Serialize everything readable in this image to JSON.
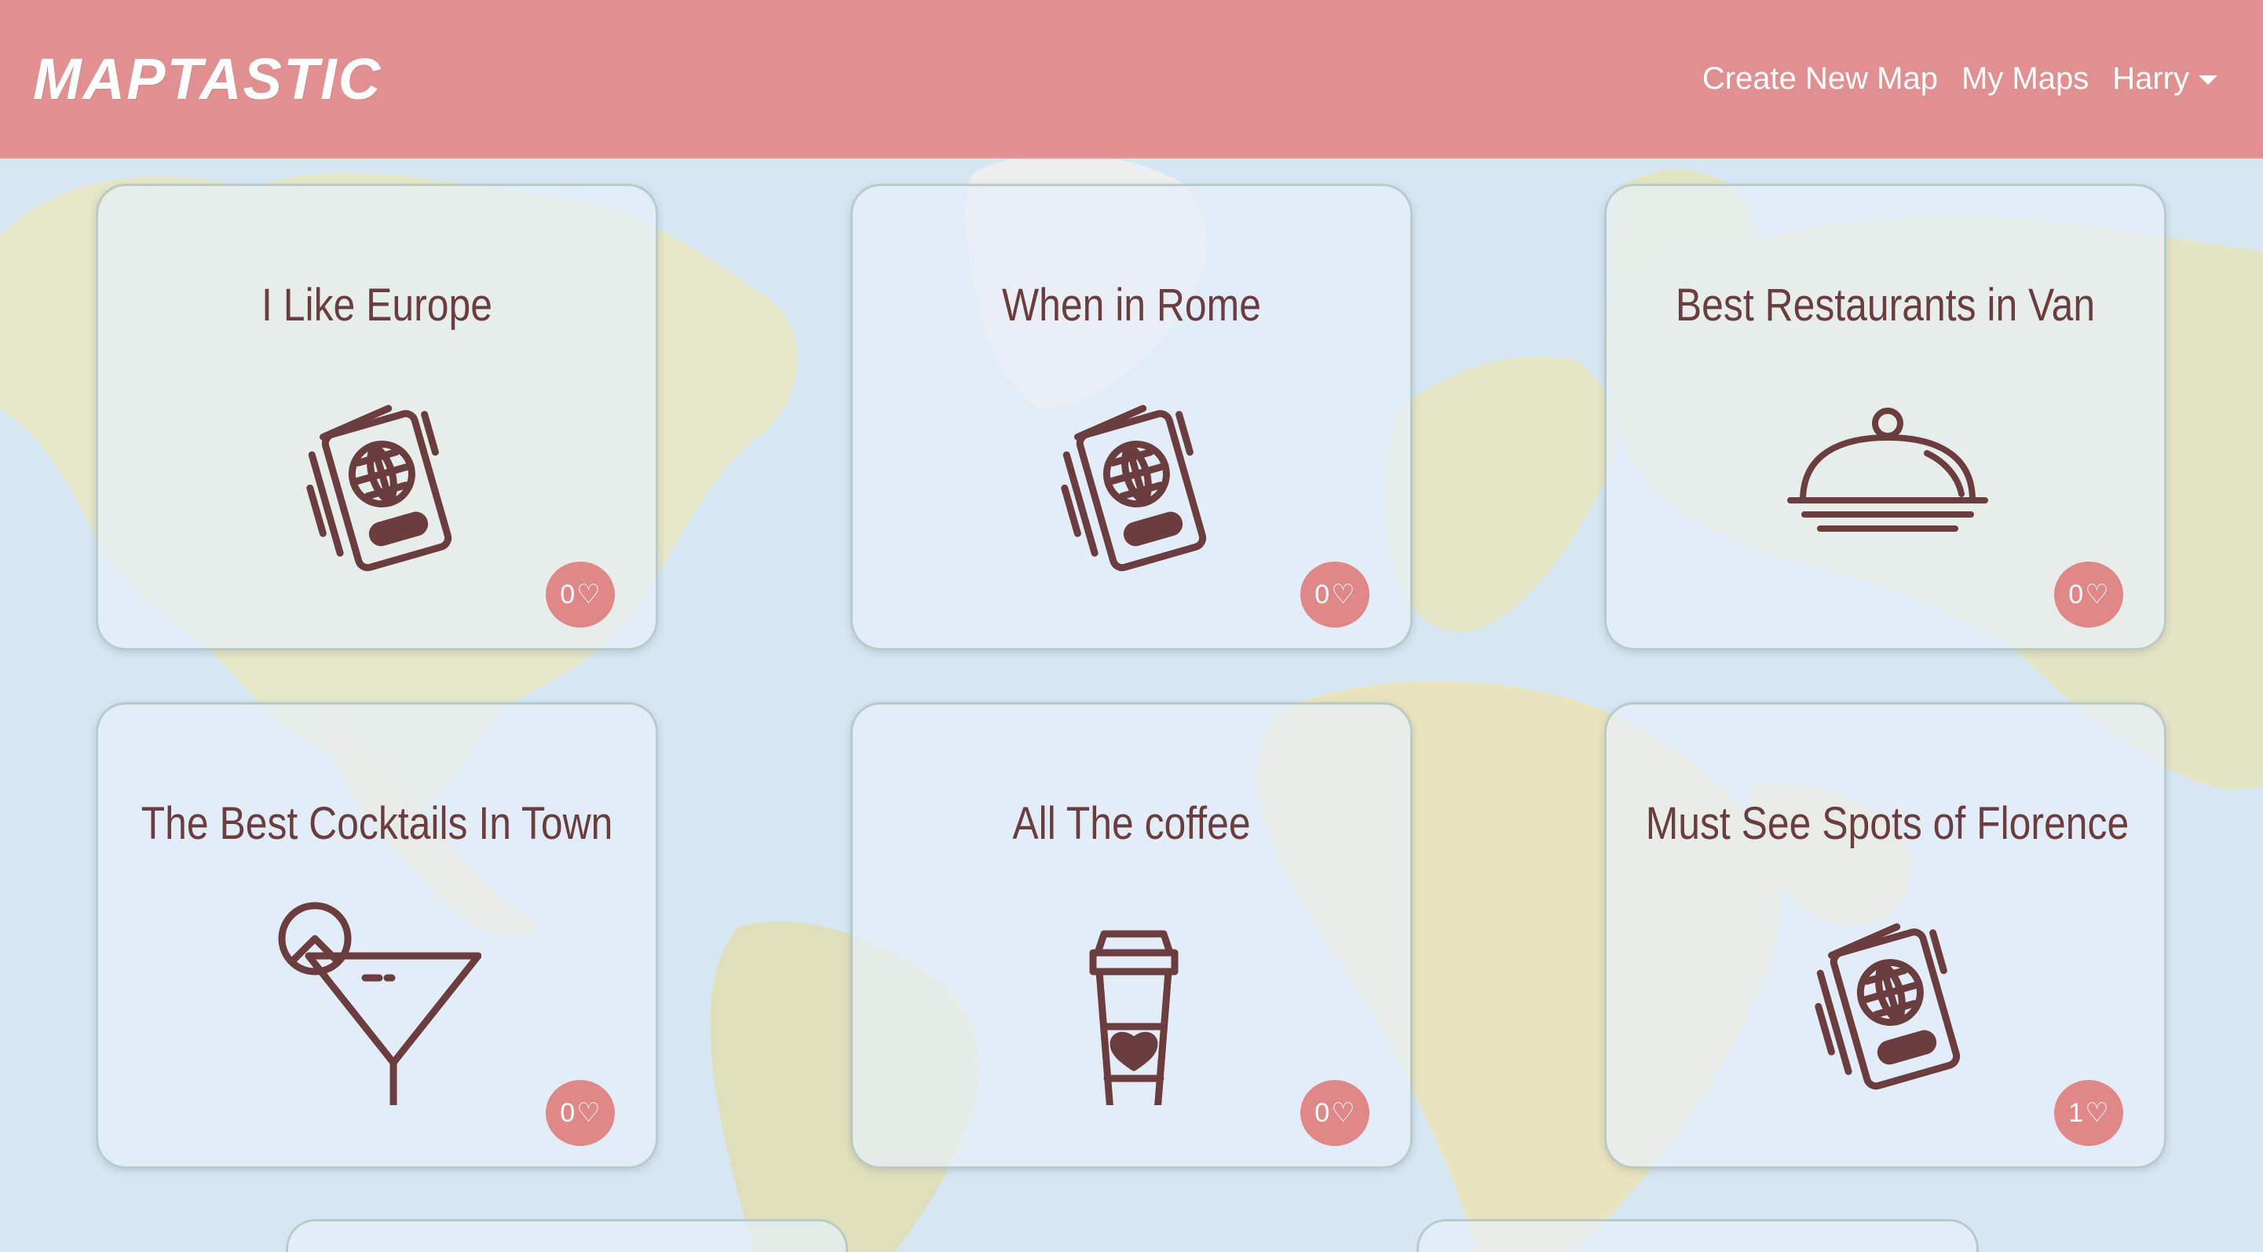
{
  "brand": {
    "name": "MAPTASTIC"
  },
  "nav": {
    "create": "Create New Map",
    "my_maps": "My Maps",
    "user": "Harry"
  },
  "cards": [
    {
      "title": "I Like Europe",
      "icon": "passport-icon",
      "likes": "0"
    },
    {
      "title": "When in Rome",
      "icon": "passport-icon",
      "likes": "0"
    },
    {
      "title": "Best Restaurants in Van",
      "icon": "cloche-icon",
      "likes": "0"
    },
    {
      "title": "The Best Cocktails In Town",
      "icon": "cocktail-icon",
      "likes": "0"
    },
    {
      "title": "All The coffee",
      "icon": "coffee-cup-icon",
      "likes": "0"
    },
    {
      "title": "Must See Spots of Florence",
      "icon": "passport-icon",
      "likes": "1"
    }
  ],
  "colors": {
    "navbar": "#e09090",
    "accent_text": "#6b3d3f",
    "badge": "#e08888"
  }
}
